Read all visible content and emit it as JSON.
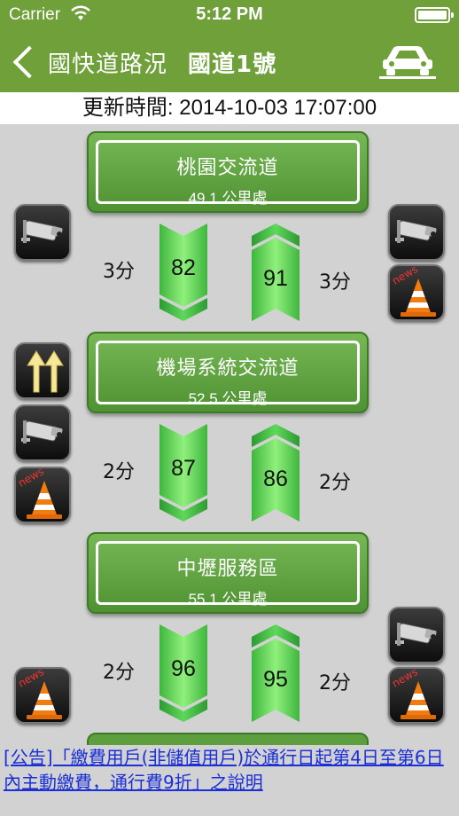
{
  "status_bar": {
    "carrier": "Carrier",
    "time": "5:12 PM"
  },
  "nav": {
    "back_label": "國快道路況",
    "title": "國道1號"
  },
  "update": {
    "label": "更新時間:",
    "value": "2014-10-03 17:07:00"
  },
  "interchanges": [
    {
      "name": "桃園交流道",
      "km": "49.1 公里處"
    },
    {
      "name": "機場系統交流道",
      "km": "52.5 公里處"
    },
    {
      "name": "中壢服務區",
      "km": "55.1 公里處"
    }
  ],
  "segments": [
    {
      "south_time": "3分",
      "south_speed": "82",
      "north_speed": "91",
      "north_time": "3分"
    },
    {
      "south_time": "2分",
      "south_speed": "87",
      "north_speed": "86",
      "north_time": "2分"
    },
    {
      "south_time": "2分",
      "south_speed": "96",
      "north_speed": "95",
      "north_time": "2分"
    }
  ],
  "icons": {
    "camera": "camera-icon",
    "news": "news-cone-icon",
    "lanes": "lane-arrows-icon",
    "news_text": "news",
    "car": "car-icon"
  },
  "colors": {
    "header_green": "#6fa03a",
    "sign_green": "#5d9e3f",
    "arrow_green": "#5fd85a",
    "link_blue": "#1a2fd8"
  },
  "notice": "[公告]「繳費用戶(非儲值用戶)於通行日起第4日至第6日內主動繳費，通行費9折」之說明"
}
